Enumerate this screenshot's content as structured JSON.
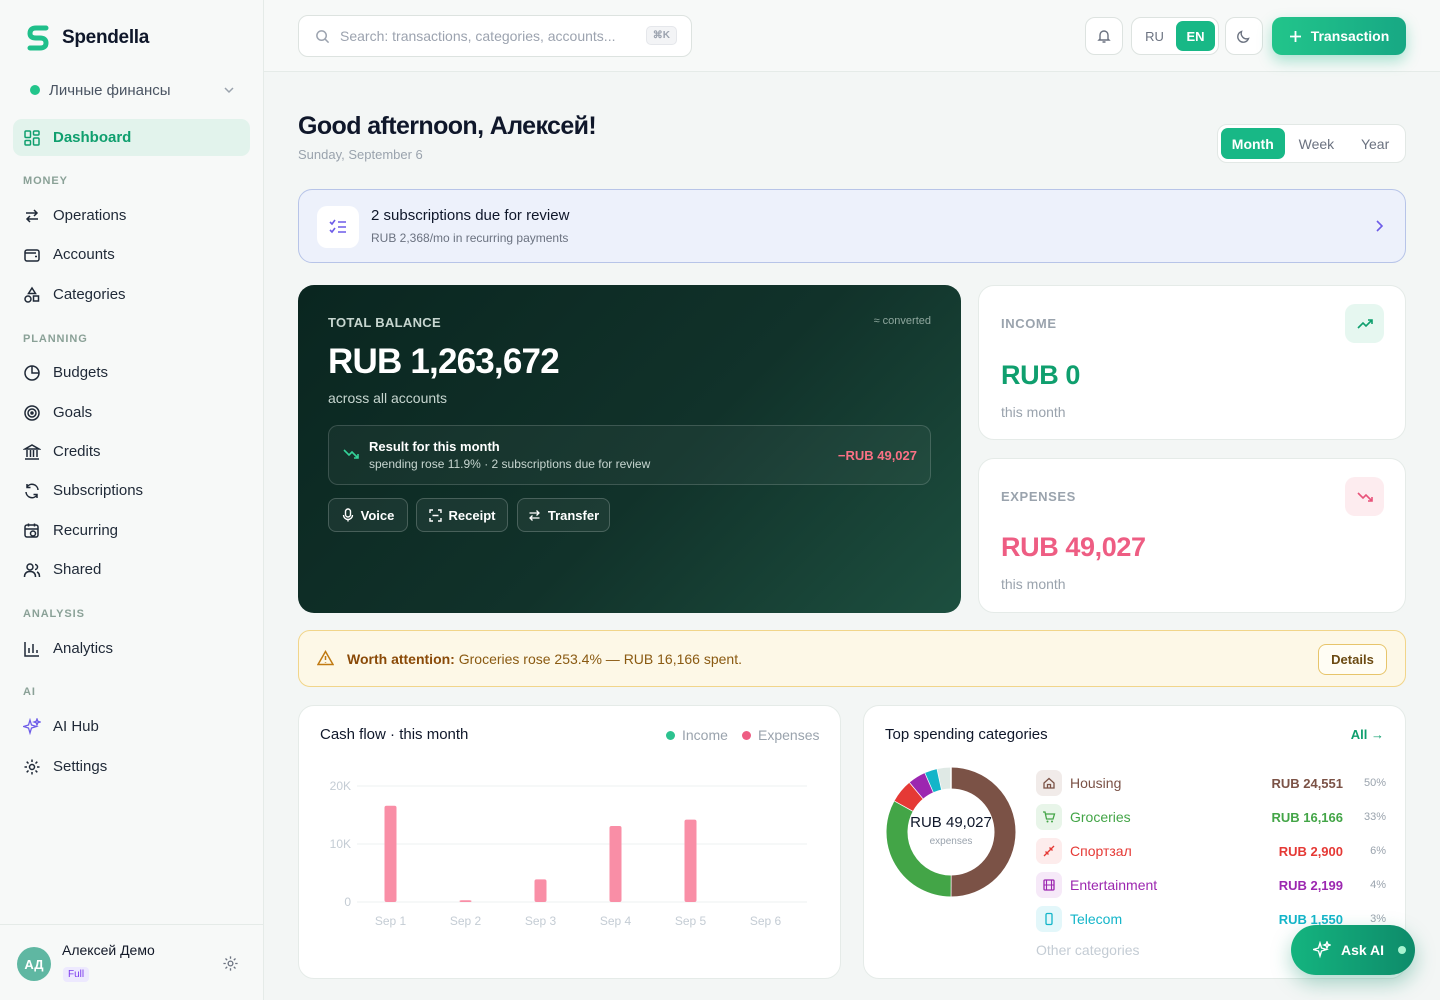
{
  "app": {
    "name": "Spendella"
  },
  "workspace": {
    "name": "Личные финансы"
  },
  "sidebar": {
    "dashboard": "Dashboard",
    "sections": {
      "money": "MONEY",
      "planning": "PLANNING",
      "analysis": "ANALYSIS",
      "ai": "AI"
    },
    "money": [
      "Operations",
      "Accounts",
      "Categories"
    ],
    "planning": [
      "Budgets",
      "Goals",
      "Credits",
      "Subscriptions",
      "Recurring",
      "Shared"
    ],
    "analysis": [
      "Analytics"
    ],
    "ai": [
      "AI Hub",
      "Settings"
    ]
  },
  "user": {
    "initials": "АД",
    "name": "Алексей Демо",
    "plan": "Full"
  },
  "topbar": {
    "search_placeholder": "Search: transactions, categories, accounts...",
    "shortcut": "⌘K",
    "lang": [
      "RU",
      "EN"
    ],
    "lang_active": "EN",
    "add_label": "Transaction"
  },
  "header": {
    "greeting": "Good afternoon, Алексей!",
    "date": "Sunday, September 6",
    "periods": [
      "Month",
      "Week",
      "Year"
    ],
    "period_active": "Month"
  },
  "subscriptions_banner": {
    "title": "2 subscriptions due for review",
    "subtitle": "RUB 2,368/mo in recurring payments"
  },
  "balance": {
    "label": "TOTAL BALANCE",
    "converted": "≈ converted",
    "amount": "RUB 1,263,672",
    "sub": "across all accounts",
    "result_title": "Result for this month",
    "result_sub": "spending rose 11.9% · 2 subscriptions due for review",
    "result_amount": "−RUB 49,027",
    "actions": [
      "Voice",
      "Receipt",
      "Transfer"
    ]
  },
  "income": {
    "label": "INCOME",
    "amount": "RUB 0",
    "sub": "this month"
  },
  "expenses": {
    "label": "EXPENSES",
    "amount": "RUB 49,027",
    "sub": "this month"
  },
  "attention": {
    "prefix": "Worth attention:",
    "text": " Groceries rose 253.4% — RUB 16,166 spent.",
    "button": "Details"
  },
  "cashflow": {
    "title": "Cash flow · this month",
    "legend": {
      "income": "Income",
      "expenses": "Expenses"
    },
    "colors": {
      "income": "#2cc28f",
      "expenses": "#f98ea6"
    }
  },
  "chart_data": {
    "type": "bar",
    "title": "Cash flow · this month",
    "categories": [
      "Sep 1",
      "Sep 2",
      "Sep 3",
      "Sep 4",
      "Sep 5",
      "Sep 6"
    ],
    "series": [
      {
        "name": "Income",
        "values": [
          0,
          0,
          0,
          0,
          0,
          0
        ]
      },
      {
        "name": "Expenses",
        "values": [
          16600,
          300,
          3900,
          13100,
          14200,
          0
        ]
      }
    ],
    "ylim": [
      0,
      20000
    ],
    "y_ticks": [
      "0",
      "10K",
      "20K"
    ],
    "grid": true,
    "legend": "top-right"
  },
  "top_categories": {
    "title": "Top spending categories",
    "all_label": "All →",
    "donut_total": "RUB 49,027",
    "donut_sub": "expenses",
    "other_label": "Other categories",
    "items": [
      {
        "name": "Housing",
        "amount": "RUB 24,551",
        "pct": "50%",
        "color": "#7b5246",
        "icon": "home-icon"
      },
      {
        "name": "Groceries",
        "amount": "RUB 16,166",
        "pct": "33%",
        "color": "#43a547",
        "icon": "cart-icon"
      },
      {
        "name": "Спортзал",
        "amount": "RUB 2,900",
        "pct": "6%",
        "color": "#e53935",
        "icon": "dumbbell-icon"
      },
      {
        "name": "Entertainment",
        "amount": "RUB 2,199",
        "pct": "4%",
        "color": "#9c27b0",
        "icon": "film-icon"
      },
      {
        "name": "Telecom",
        "amount": "RUB 1,550",
        "pct": "3%",
        "color": "#13b5c9",
        "icon": "phone-icon"
      }
    ]
  },
  "ask_ai": {
    "label": "Ask AI"
  }
}
